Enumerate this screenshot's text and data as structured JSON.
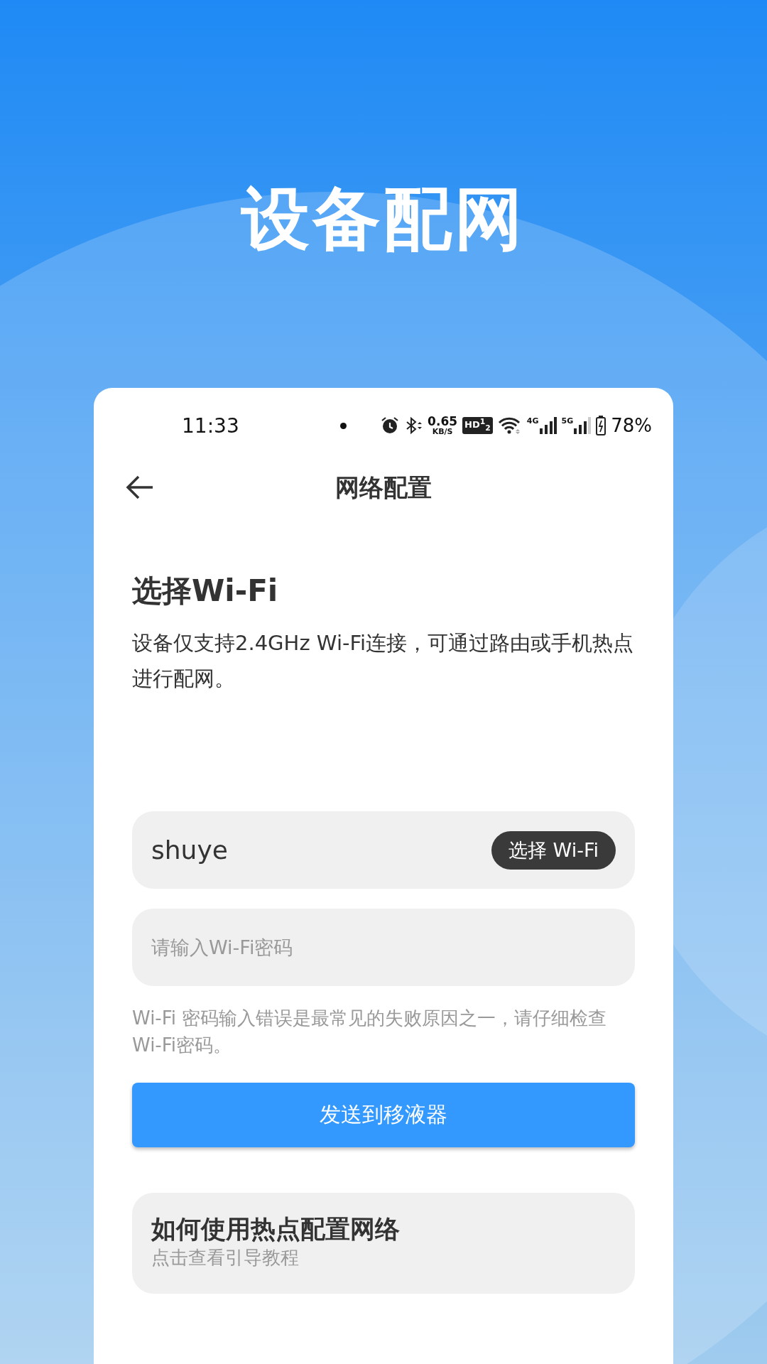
{
  "banner": {
    "title": "设备配网"
  },
  "status_bar": {
    "time": "11:33",
    "speed_value": "0.65",
    "speed_unit": "KB/S",
    "hd_label": "HD$^{1}$$_{2}$",
    "network_1": "4G",
    "network_2": "5G",
    "battery": "78%"
  },
  "nav": {
    "title": "网络配置"
  },
  "heading": "选择Wi-Fi",
  "description": "设备仅支持2.4GHz Wi-Fi连接，可通过路由或手机热点进行配网。",
  "ssid_field": {
    "value": "shuye",
    "button": "选择 Wi-Fi"
  },
  "password_field": {
    "placeholder": "请输入Wi-Fi密码"
  },
  "hint": "Wi-Fi 密码输入错误是最常见的失败原因之一，请仔细检查Wi-Fi密码。",
  "send_button": "发送到移液器",
  "help_card": {
    "title": "如何使用热点配置网络",
    "subtitle": "点击查看引导教程"
  }
}
